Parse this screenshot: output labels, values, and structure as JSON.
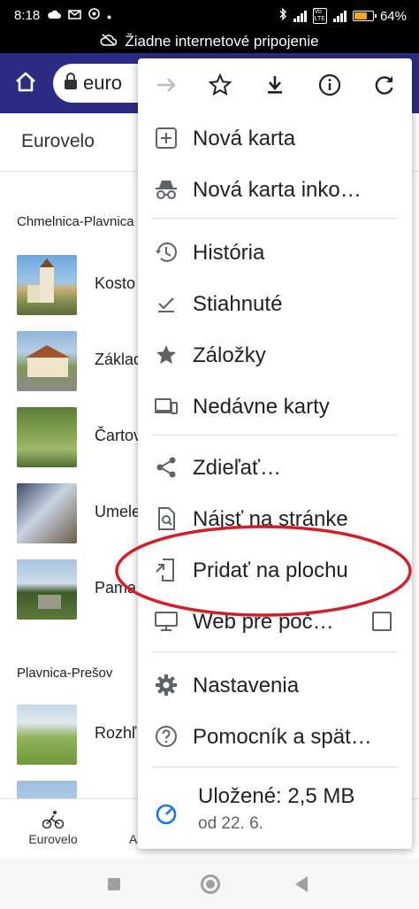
{
  "status_bar": {
    "time": "8:18",
    "battery": "64%",
    "battery_level": 0.64,
    "icons": [
      "cloud-icon",
      "gmail-icon",
      "chrome-icon",
      "dot-icon",
      "bluetooth-icon",
      "signal-icon",
      "volte-icon",
      "signal-icon",
      "battery-icon"
    ]
  },
  "offline_banner": {
    "text": "Žiadne internetové pripojenie"
  },
  "toolbar": {
    "url_partial": "euro"
  },
  "page": {
    "title": "Eurovelo",
    "sections": [
      {
        "title": "Chmelnica-Plavnica",
        "items": [
          {
            "label": "Kosto"
          },
          {
            "label": "Základ"
          },
          {
            "label": "Čartov"
          },
          {
            "label": "Umele"
          },
          {
            "label": "Pama"
          }
        ]
      },
      {
        "title": "Plavnica-Prešov",
        "items": [
          {
            "label": "Rozhľ"
          },
          {
            "label": ""
          }
        ]
      }
    ],
    "bottom_nav": [
      {
        "label": "Eurovelo",
        "icon": "cyclist-icon"
      },
      {
        "label": "A"
      }
    ]
  },
  "menu": {
    "action_icons": [
      "forward-icon",
      "star-icon",
      "download-icon",
      "info-icon",
      "refresh-icon"
    ],
    "items": [
      {
        "label": "Nová karta",
        "icon": "new-tab-icon"
      },
      {
        "label": "Nová karta inko…",
        "icon": "incognito-icon"
      },
      {
        "label": "História",
        "icon": "history-icon"
      },
      {
        "label": "Stiahnuté",
        "icon": "downloads-icon"
      },
      {
        "label": "Záložky",
        "icon": "bookmarks-star-icon"
      },
      {
        "label": "Nedávne karty",
        "icon": "recent-tabs-icon"
      },
      {
        "label": "Zdieľať…",
        "icon": "share-icon"
      },
      {
        "label": "Nájsť na stránke",
        "icon": "find-in-page-icon"
      },
      {
        "label": "Pridať na plochu",
        "icon": "add-to-home-icon"
      },
      {
        "label": "Web pre poč…",
        "icon": "desktop-icon",
        "checked": false
      },
      {
        "label": "Nastavenia",
        "icon": "settings-icon"
      },
      {
        "label": "Pomocník a spät…",
        "icon": "help-icon"
      }
    ],
    "savings": {
      "line1": "Uložené: 2,5 MB",
      "line2": "od 22. 6.",
      "icon": "data-saver-icon"
    }
  },
  "annotation": {
    "shape": "ellipse",
    "color": "#d0202a"
  },
  "colors": {
    "toolbar": "#2c2c84",
    "menu_icon": "#5f6368",
    "battery": "#f5a623"
  }
}
